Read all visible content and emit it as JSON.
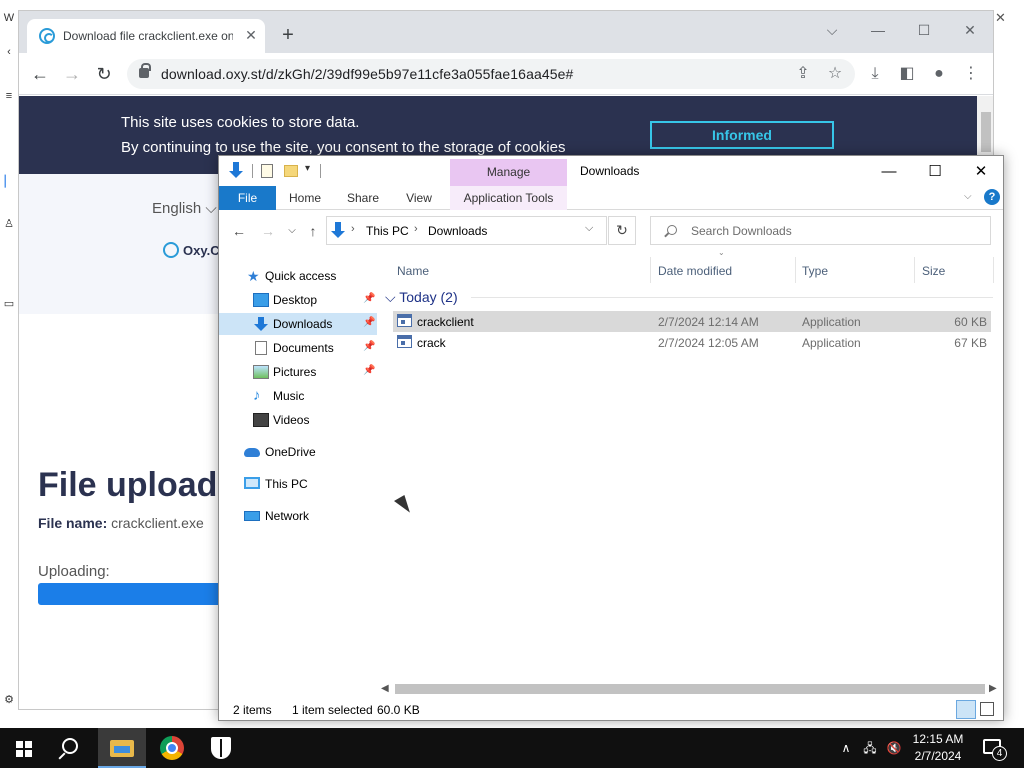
{
  "chrome": {
    "tab_title": "Download file crackclient.exe on",
    "tab_close": "✕",
    "new_tab": "+",
    "url": "download.oxy.st/d/zkGh/2/39df99e5b97e11cfe3a055fae16aa45e#",
    "controls": {
      "tab_search": "⌵",
      "minimize": "—",
      "maximize": "☐",
      "close": "✕"
    },
    "toolbar_icons": [
      "back-icon",
      "forward-icon",
      "reload-icon",
      "share-icon",
      "star-icon",
      "download-icon",
      "side-panel-icon",
      "profile-icon",
      "menu-icon"
    ]
  },
  "page": {
    "cookie_line1": "This site uses cookies to store data.",
    "cookie_line2": "By continuing to use the site, you consent to the storage of cookies",
    "informed_button": "Informed",
    "language": "English",
    "logo_text": "Oxy.Cl",
    "upload_title": "File upload",
    "file_name_label": "File name:",
    "file_name_value": "crackclient.exe",
    "uploading_label": "Uploading:",
    "upload_progress": 0.2,
    "colors": {
      "banner": "#2b3250",
      "accent": "#37c6e8",
      "progress": "#1b7ee8"
    }
  },
  "explorer": {
    "title": "Downloads",
    "manage_tab": "Manage",
    "ribbon": {
      "file": "File",
      "home": "Home",
      "share": "Share",
      "view": "View",
      "app_tools": "Application Tools"
    },
    "controls": {
      "minimize": "—",
      "maximize": "☐",
      "close": "✕"
    },
    "help": "?",
    "address": {
      "this_pc": "This PC",
      "downloads": "Downloads"
    },
    "search_placeholder": "Search Downloads",
    "nav_pane": [
      {
        "label": "Quick access",
        "icon": "quick-access-star-icon"
      },
      {
        "label": "Desktop",
        "icon": "desktop-folder-icon",
        "pinned": true
      },
      {
        "label": "Downloads",
        "icon": "downloads-folder-icon",
        "pinned": true,
        "selected": true
      },
      {
        "label": "Documents",
        "icon": "documents-folder-icon",
        "pinned": true
      },
      {
        "label": "Pictures",
        "icon": "pictures-folder-icon",
        "pinned": true
      },
      {
        "label": "Music",
        "icon": "music-folder-icon"
      },
      {
        "label": "Videos",
        "icon": "videos-folder-icon"
      },
      {
        "label": "OneDrive",
        "icon": "onedrive-icon"
      },
      {
        "label": "This PC",
        "icon": "this-pc-icon"
      },
      {
        "label": "Network",
        "icon": "network-icon"
      }
    ],
    "columns": {
      "name": "Name",
      "date": "Date modified",
      "type": "Type",
      "size": "Size"
    },
    "group": "Today (2)",
    "files": [
      {
        "name": "crackclient",
        "date": "2/7/2024 12:14 AM",
        "type": "Application",
        "size": "60 KB",
        "selected": true
      },
      {
        "name": "crack",
        "date": "2/7/2024 12:05 AM",
        "type": "Application",
        "size": "67 KB",
        "selected": false
      }
    ],
    "status": {
      "items": "2 items",
      "selected": "1 item selected",
      "size": "60.0 KB"
    }
  },
  "taskbar": {
    "apps": [
      "start-icon",
      "search-icon",
      "file-explorer-icon",
      "chrome-icon",
      "security-shield-icon"
    ],
    "time": "12:15 AM",
    "date": "2/7/2024",
    "notifications": "4"
  }
}
